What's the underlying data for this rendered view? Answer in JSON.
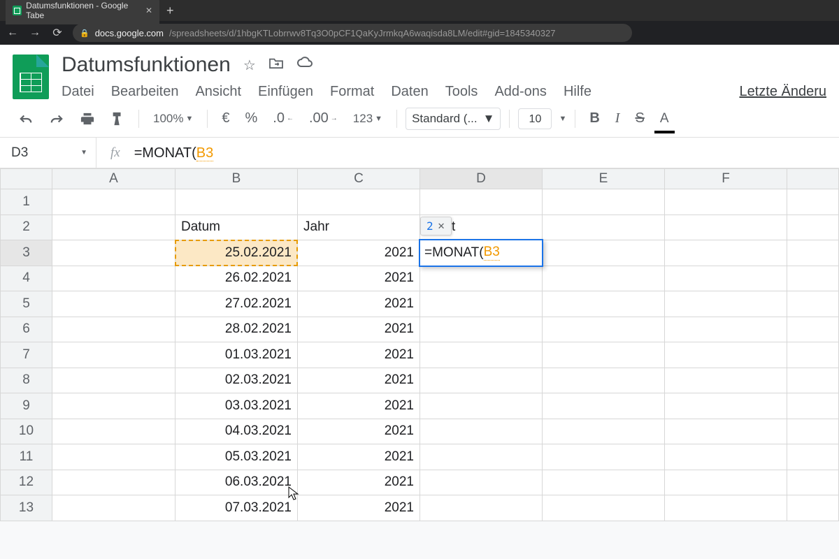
{
  "browser": {
    "tab_title": "Datumsfunktionen - Google Tabe",
    "url_host": "docs.google.com",
    "url_path": "/spreadsheets/d/1hbgKTLobrrwv8Tq3O0pCF1QaKyJrmkqA6waqisda8LM/edit#gid=1845340327"
  },
  "doc": {
    "title": "Datumsfunktionen",
    "menus": [
      "Datei",
      "Bearbeiten",
      "Ansicht",
      "Einfügen",
      "Format",
      "Daten",
      "Tools",
      "Add-ons",
      "Hilfe"
    ],
    "last_edit": "Letzte Änderu"
  },
  "toolbar": {
    "zoom": "100%",
    "currency": "€",
    "percent": "%",
    "dec_less": ".0",
    "dec_more": ".00",
    "numfmt": "123",
    "font": "Standard (...",
    "size": "10",
    "bold": "B",
    "italic": "I",
    "strike": "S",
    "color": "A"
  },
  "formula_bar": {
    "cell_ref": "D3",
    "prefix": "=MONAT(",
    "ref": "B3"
  },
  "columns": [
    "A",
    "B",
    "C",
    "D",
    "E",
    "F"
  ],
  "headers": {
    "B2": "Datum",
    "C2": "Jahr",
    "D2_fragment": "at"
  },
  "rows": [
    {
      "n": 1
    },
    {
      "n": 2
    },
    {
      "n": 3,
      "B": "25.02.2021",
      "C": "2021",
      "D_edit_prefix": "=MONAT(",
      "D_edit_ref": "B3",
      "D_preview": "2"
    },
    {
      "n": 4,
      "B": "26.02.2021",
      "C": "2021"
    },
    {
      "n": 5,
      "B": "27.02.2021",
      "C": "2021"
    },
    {
      "n": 6,
      "B": "28.02.2021",
      "C": "2021"
    },
    {
      "n": 7,
      "B": "01.03.2021",
      "C": "2021"
    },
    {
      "n": 8,
      "B": "02.03.2021",
      "C": "2021"
    },
    {
      "n": 9,
      "B": "03.03.2021",
      "C": "2021"
    },
    {
      "n": 10,
      "B": "04.03.2021",
      "C": "2021"
    },
    {
      "n": 11,
      "B": "05.03.2021",
      "C": "2021"
    },
    {
      "n": 12,
      "B": "06.03.2021",
      "C": "2021"
    },
    {
      "n": 13,
      "B": "07.03.2021",
      "C": "2021"
    }
  ]
}
